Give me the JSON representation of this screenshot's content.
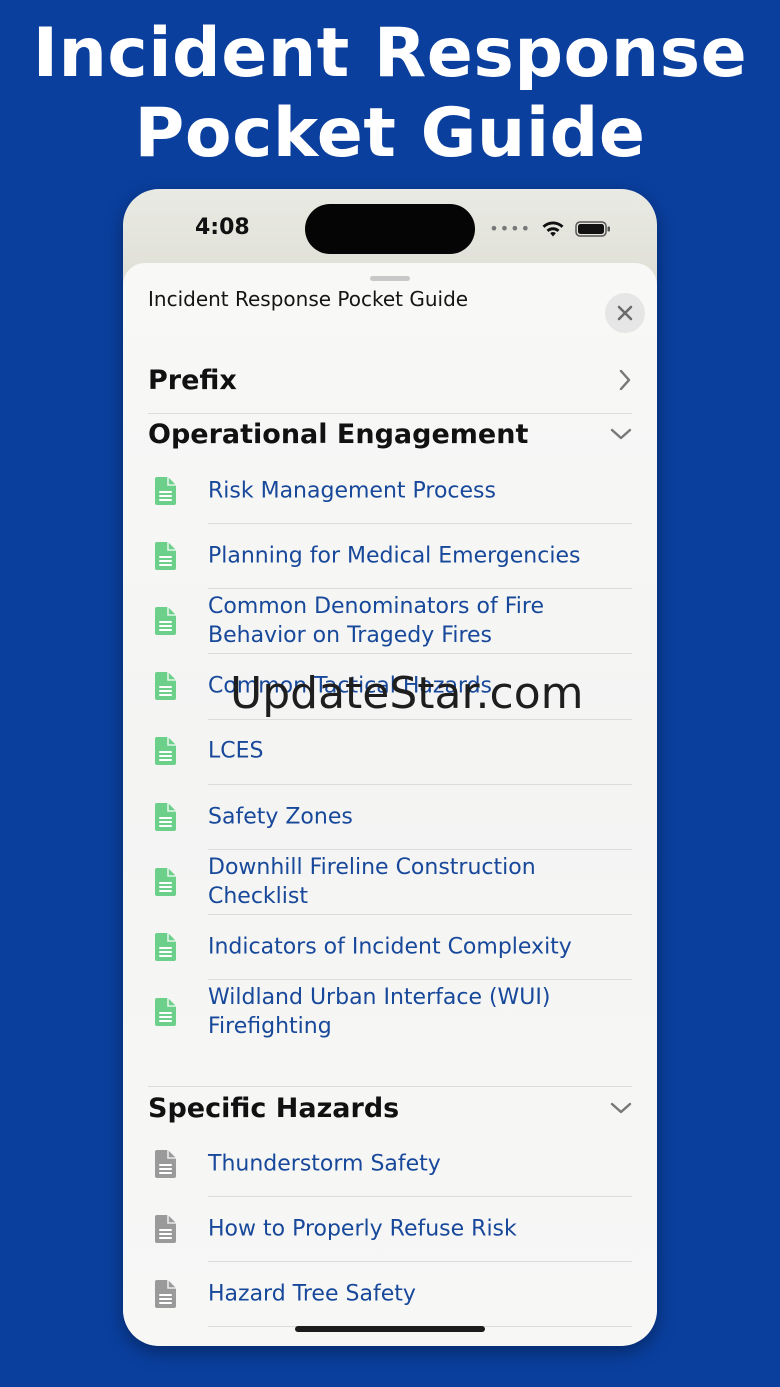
{
  "headline": {
    "line1": "Incident Response",
    "line2": "Pocket Guide"
  },
  "status_bar": {
    "time": "4:08",
    "signal_icon": "dots",
    "wifi_icon": "wifi-icon",
    "battery_icon": "battery-icon"
  },
  "sheet": {
    "title": "Incident Response Pocket Guide",
    "close_icon": "close-icon"
  },
  "sections": {
    "prefix": {
      "label": "Prefix",
      "icon": "chevron-right-icon"
    },
    "operational": {
      "label": "Operational Engagement",
      "icon": "chevron-down-icon",
      "items": [
        "Risk Management Process",
        "Planning for Medical Emergencies",
        "Common Denominators of Fire Behavior on Tragedy Fires",
        "Common Tactical Hazards",
        "LCES",
        "Safety Zones",
        "Downhill Fireline Construction Checklist",
        "Indicators of Incident Complexity",
        "Wildland Urban Interface (WUI) Firefighting"
      ]
    },
    "hazards": {
      "label": "Specific Hazards",
      "icon": "chevron-down-icon",
      "items": [
        "Thunderstorm Safety",
        "How to Properly Refuse Risk",
        "Hazard Tree Safety"
      ]
    }
  },
  "colors": {
    "background": "#0a3f9e",
    "link": "#17489a",
    "doc_green": "#6ccf8a",
    "doc_gray": "#9a9a9a"
  },
  "watermark": "UpdateStar.com"
}
